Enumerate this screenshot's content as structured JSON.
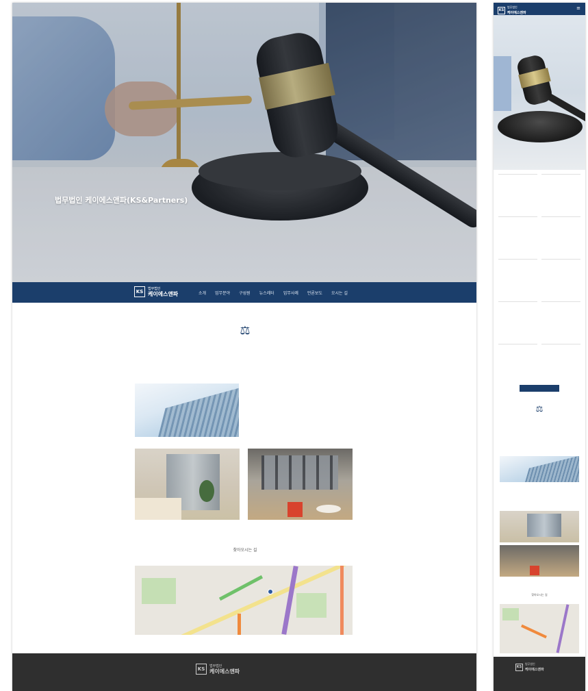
{
  "brand": {
    "small": "법무법인",
    "name": "케이에스앤파",
    "mark": "KS"
  },
  "desktop": {
    "hero": {
      "title": "법무법인 케이에스앤파(KS&Partners)",
      "desc": "",
      "desc_line2": ""
    },
    "nav": [
      "소개",
      "업무분야",
      "구성원",
      "뉴스레터",
      "업무사례",
      "언론보도",
      "오시는 길"
    ],
    "intro": [
      "",
      "",
      ""
    ],
    "building_text": "",
    "map_title": "찾아오시는 길",
    "footer_lines": [
      "",
      "",
      ""
    ]
  },
  "mobile": {
    "menu_icon": "≡",
    "hero_title": "",
    "news": [
      {
        "title": "",
        "body": ""
      },
      {
        "title": "",
        "body": ""
      },
      {
        "title": "",
        "body": ""
      },
      {
        "title": "",
        "body": ""
      },
      {
        "title": "",
        "body": ""
      },
      {
        "title": "",
        "body": ""
      },
      {
        "title": "",
        "body": ""
      },
      {
        "title": "",
        "body": ""
      },
      {
        "title": "",
        "body": ""
      },
      {
        "title": "",
        "body": ""
      }
    ],
    "more_button": "",
    "intro": "",
    "building_text": "",
    "map_title": "찾아오시는 길",
    "footer": ""
  },
  "icons": {
    "scale": "⚖",
    "menu": "menu-icon",
    "map_pin": "map-pin-icon"
  },
  "colors": {
    "primary": "#1b3e6b",
    "footer": "#2f2f2f",
    "background": "#ffffff"
  }
}
